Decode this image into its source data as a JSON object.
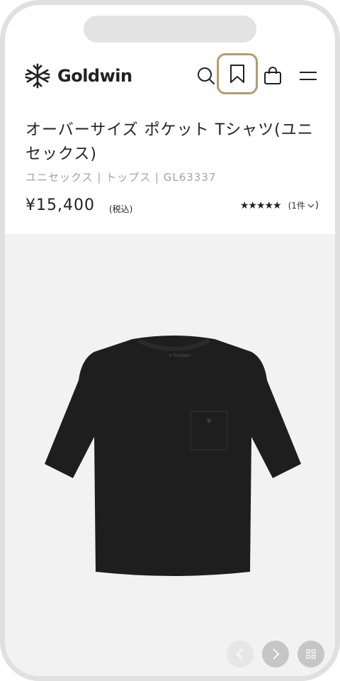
{
  "header": {
    "logo_text": "Goldwin",
    "icons": {
      "search": "search-icon",
      "bookmark": "bookmark-icon",
      "cart": "shopping-bag-icon",
      "menu": "menu-icon"
    },
    "bookmark_highlight_color": "#b49b71"
  },
  "product": {
    "title": "オーバーサイズ ポケット Tシャツ(ユニセックス)",
    "meta": "ユニセックス | トップス | GL63337",
    "price": "¥15,400",
    "tax_label": "(税込)",
    "stars": "★★★★★",
    "review_count": "(1件",
    "rating_value": 5
  },
  "gallery": {
    "background": "#f2f2f2",
    "image": "black-pocket-tshirt",
    "controls": [
      "chevron-left-icon",
      "chevron-right-icon",
      "grid-icon"
    ]
  }
}
